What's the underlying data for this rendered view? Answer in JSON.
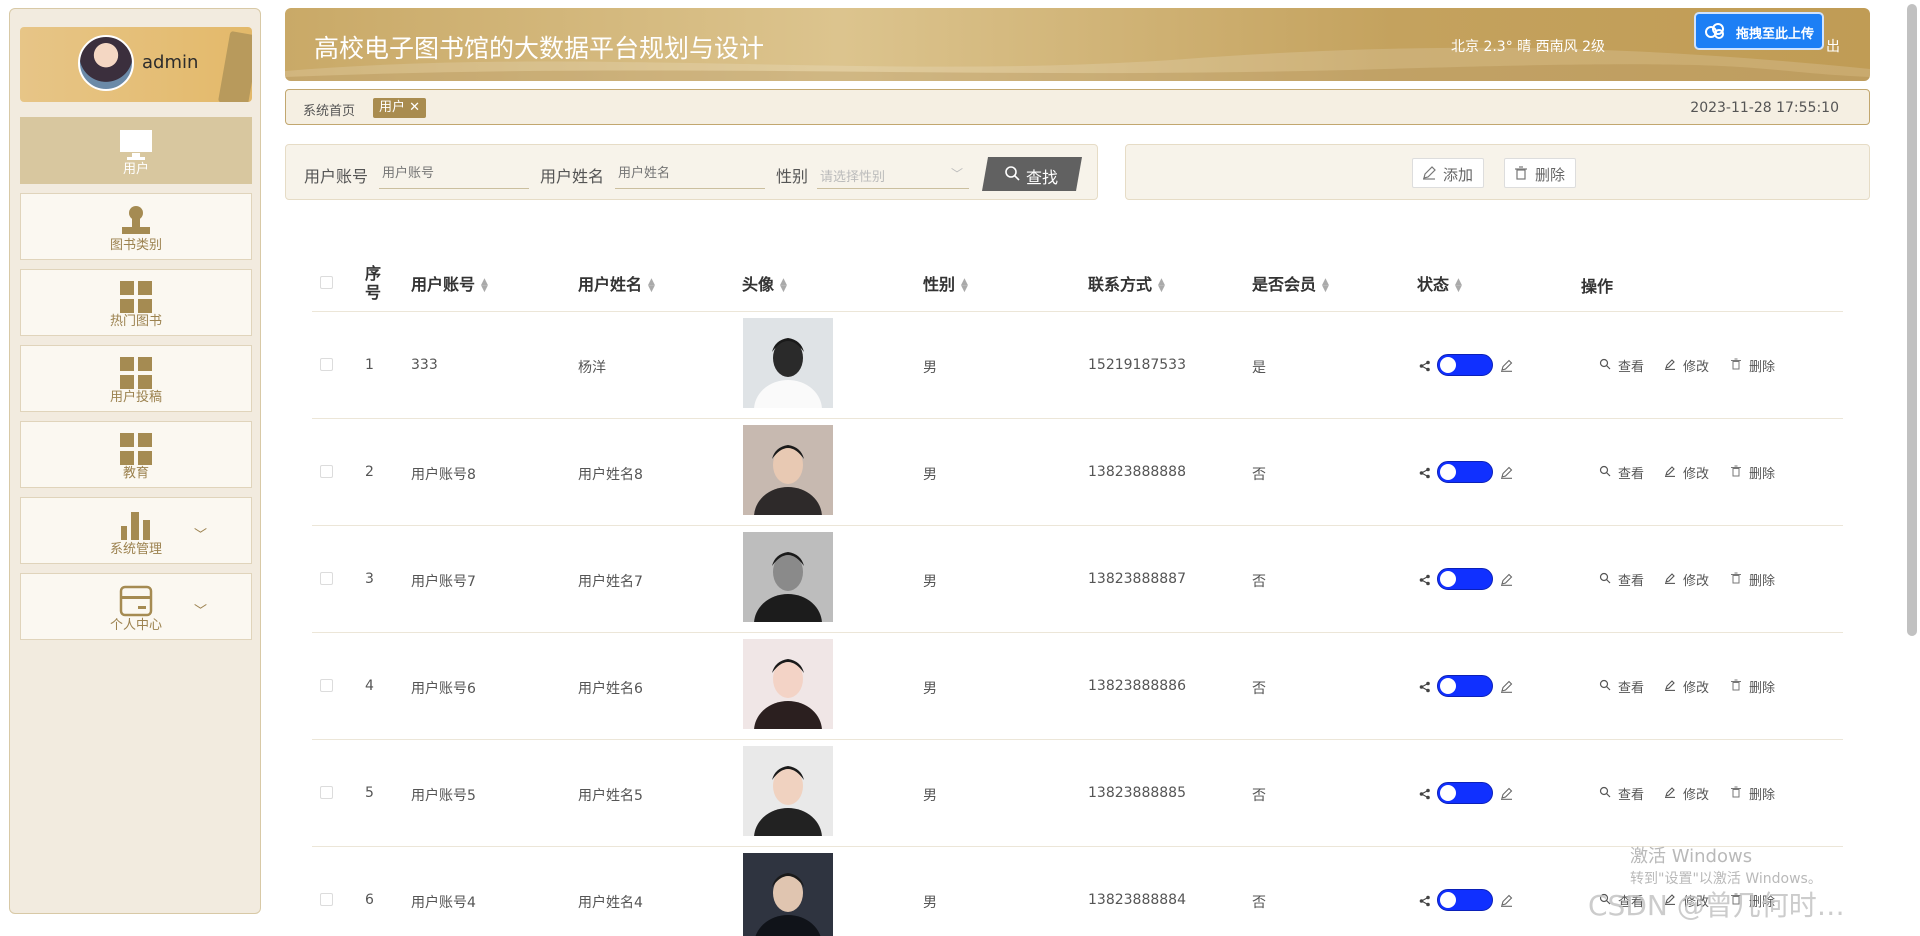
{
  "app": {
    "title": "高校电子图书馆的大数据平台规划与设计",
    "weather": "北京  2.3°  晴  西南风  2级",
    "logout": "出",
    "upload_badge": "拖拽至此上传"
  },
  "user": {
    "name": "admin"
  },
  "sidebar": {
    "items": [
      {
        "label": "用户",
        "icon": "monitor-icon",
        "active": true
      },
      {
        "label": "图书类别",
        "icon": "stamp-icon"
      },
      {
        "label": "热门图书",
        "icon": "grid-icon"
      },
      {
        "label": "用户投稿",
        "icon": "grid-icon"
      },
      {
        "label": "教育",
        "icon": "grid-icon"
      },
      {
        "label": "系统管理",
        "icon": "bar-chart-icon",
        "expandable": true
      },
      {
        "label": "个人中心",
        "icon": "card-icon",
        "expandable": true
      }
    ]
  },
  "breadcrumb": {
    "home": "系统首页",
    "tag": "用户 ✕",
    "datetime": "2023-11-28 17:55:10"
  },
  "search": {
    "account_label": "用户账号",
    "account_placeholder": "用户账号",
    "name_label": "用户姓名",
    "name_placeholder": "用户姓名",
    "gender_label": "性别",
    "gender_placeholder": "请选择性别",
    "button": "查找"
  },
  "actions": {
    "add": "添加",
    "delete": "删除"
  },
  "table": {
    "headers": {
      "seq": "序号",
      "account": "用户账号",
      "name": "用户姓名",
      "avatar": "头像",
      "gender": "性别",
      "contact": "联系方式",
      "member": "是否会员",
      "status": "状态",
      "ops": "操作"
    },
    "op_labels": {
      "view": "查看",
      "edit": "修改",
      "delete": "删除"
    },
    "rows": [
      {
        "seq": "1",
        "account": "333",
        "name": "杨洋",
        "gender": "男",
        "contact": "15219187533",
        "member": "是"
      },
      {
        "seq": "2",
        "account": "用户账号8",
        "name": "用户姓名8",
        "gender": "男",
        "contact": "13823888888",
        "member": "否"
      },
      {
        "seq": "3",
        "account": "用户账号7",
        "name": "用户姓名7",
        "gender": "男",
        "contact": "13823888887",
        "member": "否"
      },
      {
        "seq": "4",
        "account": "用户账号6",
        "name": "用户姓名6",
        "gender": "男",
        "contact": "13823888886",
        "member": "否"
      },
      {
        "seq": "5",
        "account": "用户账号5",
        "name": "用户姓名5",
        "gender": "男",
        "contact": "13823888885",
        "member": "否"
      },
      {
        "seq": "6",
        "account": "用户账号4",
        "name": "用户姓名4",
        "gender": "男",
        "contact": "13823888884",
        "member": "否"
      }
    ]
  },
  "overlay": {
    "activate_title": "激活 Windows",
    "activate_sub": "转到\"设置\"以激活 Windows。",
    "csdn": "CSDN @曾几何时…"
  },
  "colors": {
    "accent": "#c9a967",
    "toggle": "#1030ff",
    "active_menu": "#d8c79f"
  }
}
